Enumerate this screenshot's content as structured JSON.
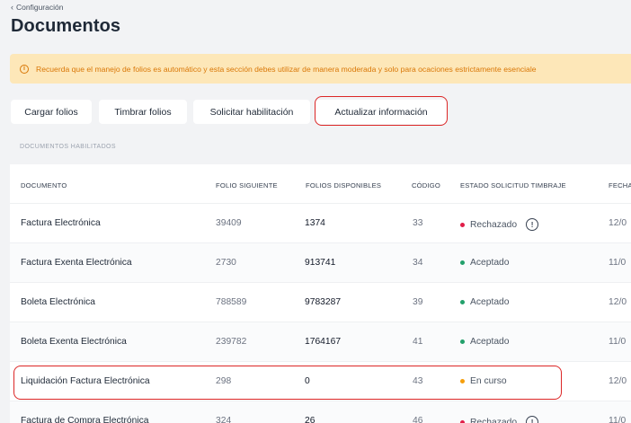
{
  "breadcrumb": {
    "label": "Configuración"
  },
  "page": {
    "title": "Documentos"
  },
  "alert": {
    "text": "Recuerda que el manejo de folios es automático y esta sección debes utilizar de manera moderada y solo para ocaciones estrictamente esenciale"
  },
  "actions": {
    "cargar": "Cargar folios",
    "timbrar": "Timbrar folios",
    "solicitar": "Solicitar habilitación",
    "actualizar": "Actualizar información"
  },
  "section": {
    "label": "DOCUMENTOS HABILITADOS"
  },
  "table": {
    "columns": [
      "DOCUMENTO",
      "FOLIO SIGUIENTE",
      "FOLIOS DISPONIBLES",
      "CÓDIGO",
      "ESTADO SOLICITUD TIMBRAJE",
      "FECHA"
    ],
    "rows": [
      {
        "documento": "Factura Electrónica",
        "folio": "39409",
        "disponibles": "1374",
        "codigo": "33",
        "estado": "Rechazado",
        "fecha": "12/0"
      },
      {
        "documento": "Factura Exenta Electrónica",
        "folio": "2730",
        "disponibles": "913741",
        "codigo": "34",
        "estado": "Aceptado",
        "fecha": "11/0"
      },
      {
        "documento": "Boleta Electrónica",
        "folio": "788589",
        "disponibles": "9783287",
        "codigo": "39",
        "estado": "Aceptado",
        "fecha": "12/0"
      },
      {
        "documento": "Boleta Exenta Electrónica",
        "folio": "239782",
        "disponibles": "1764167",
        "codigo": "41",
        "estado": "Aceptado",
        "fecha": "11/0"
      },
      {
        "documento": "Liquidación Factura Electrónica",
        "folio": "298",
        "disponibles": "0",
        "codigo": "43",
        "estado": "En curso",
        "fecha": "12/0"
      },
      {
        "documento": "Factura de Compra Electrónica",
        "folio": "324",
        "disponibles": "26",
        "codigo": "46",
        "estado": "Rechazado",
        "fecha": "11/0"
      }
    ]
  },
  "status_colors": {
    "rechazado": "#e11d48",
    "aceptado": "#22a06b",
    "en_curso": "#f59e0b"
  },
  "colors": {
    "highlight": "#dc2626",
    "alert_bg": "#fde7b8",
    "alert_text": "#d97706"
  }
}
